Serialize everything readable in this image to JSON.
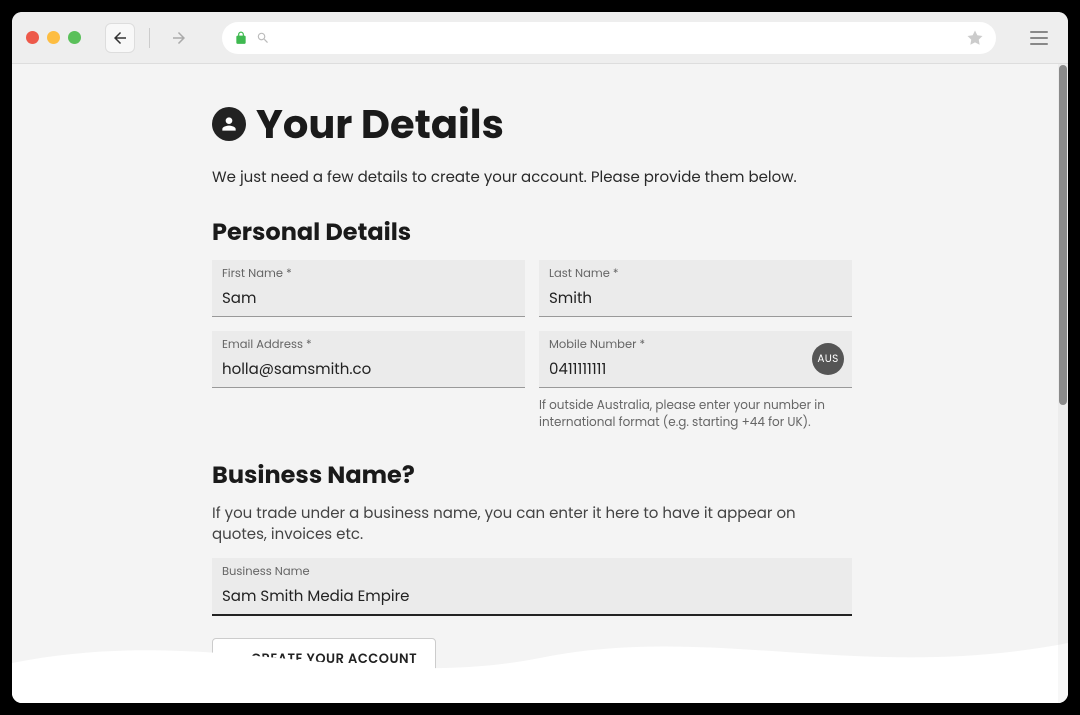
{
  "header": {
    "title": "Your Details",
    "subtitle": "We just need a few details to create your account. Please provide them below."
  },
  "personal": {
    "section_title": "Personal Details",
    "first_name": {
      "label": "First Name *",
      "value": "Sam"
    },
    "last_name": {
      "label": "Last Name *",
      "value": "Smith"
    },
    "email": {
      "label": "Email Address *",
      "value": "holla@samsmith.co"
    },
    "mobile": {
      "label": "Mobile Number *",
      "value": "0411111111",
      "country_chip": "AUS",
      "hint": "If outside Australia, please enter your number in international format (e.g. starting +44 for UK)."
    }
  },
  "business": {
    "section_title": "Business Name?",
    "description": "If you trade under a business name, you can enter it here to have it appear on quotes, invoices etc.",
    "field": {
      "label": "Business Name",
      "value": "Sam Smith Media Empire"
    }
  },
  "actions": {
    "create_label": "CREATE YOUR ACCOUNT"
  }
}
